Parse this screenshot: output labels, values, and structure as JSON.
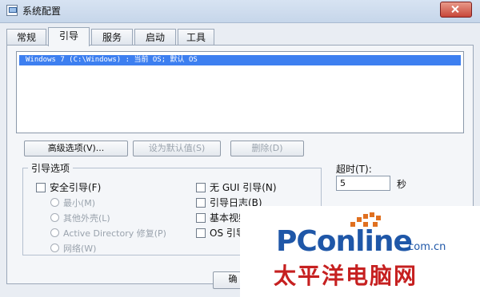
{
  "window": {
    "title": "系统配置"
  },
  "tabs": [
    {
      "label": "常规"
    },
    {
      "label": "引导"
    },
    {
      "label": "服务"
    },
    {
      "label": "启动"
    },
    {
      "label": "工具"
    }
  ],
  "boot_list": {
    "selected_entry": "Windows 7 (C:\\Windows) : 当前 OS; 默认 OS"
  },
  "buttons": {
    "advanced": "高级选项(V)...",
    "set_default": "设为默认值(S)",
    "delete": "删除(D)",
    "ok": "确"
  },
  "boot_options": {
    "legend": "引导选项",
    "safe_boot": "安全引导(F)",
    "minimal": "最小(M)",
    "alternate_shell": "其他外壳(L)",
    "ad_repair": "Active Directory 修复(P)",
    "network": "网络(W)",
    "no_gui_boot": "无 GUI 引导(N)",
    "boot_log": "引导日志(B)",
    "base_video": "基本视频(E)",
    "os_boot_info": "OS 引导信息(O)"
  },
  "timeout": {
    "label": "超时(T):",
    "value": "5",
    "unit": "秒"
  },
  "watermark": {
    "logo": "PConline",
    "domain": ".com.cn",
    "subtitle": "太平洋电脑网"
  }
}
